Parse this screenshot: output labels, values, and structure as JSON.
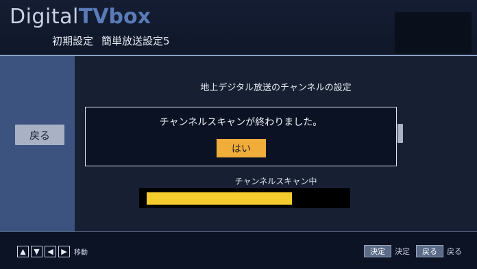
{
  "header": {
    "logo_part1": "Digital",
    "logo_part2": "TVbox",
    "subtitle_main": "初期設定",
    "subtitle_step": "簡単放送設定5"
  },
  "sidebar": {
    "back_label": "戻る"
  },
  "main": {
    "title": "地上デジタル放送のチャンネルの設定",
    "dialog": {
      "message": "チャンネルスキャンが終わりました。",
      "yes_label": "はい"
    },
    "scan_label": "チャンネルスキャン中",
    "progress_fraction": 0.74
  },
  "footer": {
    "nav_icons": [
      "up-arrow-icon",
      "down-arrow-icon",
      "left-arrow-icon",
      "right-arrow-icon"
    ],
    "move_label": "移動",
    "decide_key": "決定",
    "decide_label": "決定",
    "back_key": "戻る",
    "back_label": "戻る"
  },
  "colors": {
    "accent_yes": "#f1ad3a",
    "progress": "#f4cc2d",
    "sidebar": "#3c5380",
    "logo_bold": "#5a7bb8"
  }
}
